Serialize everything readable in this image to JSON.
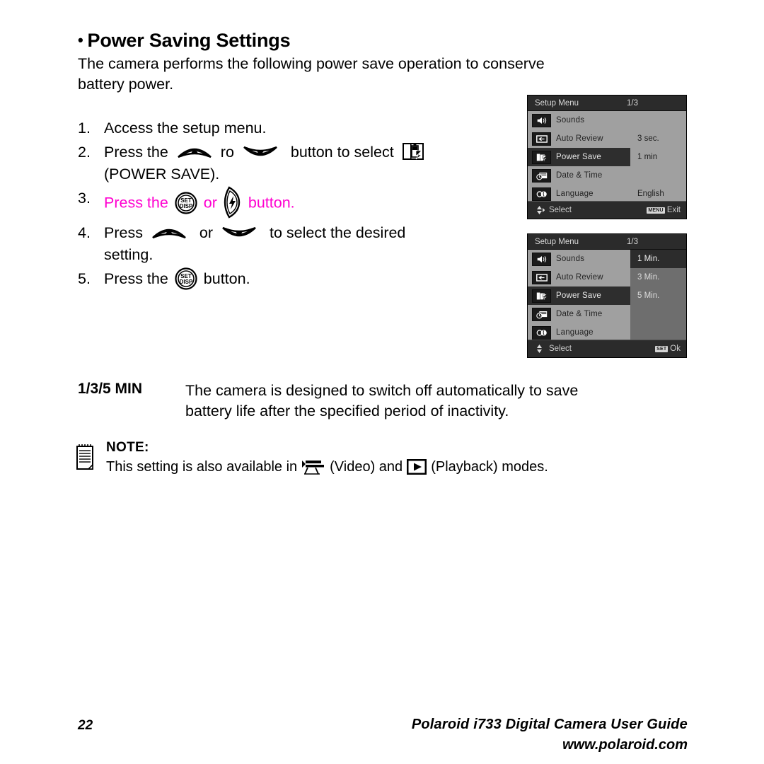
{
  "heading": {
    "bullet": "•",
    "title": "Power Saving Settings"
  },
  "intro": {
    "line1": "The camera performs the following power save operation to conserve",
    "line2": "battery power."
  },
  "steps": [
    {
      "num": "1.",
      "parts": [
        "Access the setup menu."
      ]
    },
    {
      "num": "2.",
      "pre": "Press the",
      "mid": "ro",
      "post": "button to select",
      "tail": "(POWER SAVE)."
    },
    {
      "num": "3.",
      "pre": "Press the",
      "mid": "or",
      "post": "button."
    },
    {
      "num": "4.",
      "pre": "Press",
      "mid": "or",
      "post": "to select the desired",
      "tail": "setting."
    },
    {
      "num": "5.",
      "pre": "Press the",
      "post": "button."
    }
  ],
  "lcd1": {
    "title": "Setup Menu",
    "page": "1/3",
    "rows": [
      {
        "icon": "speaker-icon",
        "label": "Sounds",
        "value": "",
        "selected": false
      },
      {
        "icon": "auto-review-icon",
        "label": "Auto Review",
        "value": "3 sec.",
        "selected": false
      },
      {
        "icon": "power-save-icon",
        "label": "Power Save",
        "value": "1 min",
        "selected": true
      },
      {
        "icon": "date-time-icon",
        "label": "Date & Time",
        "value": "",
        "selected": false
      },
      {
        "icon": "language-icon",
        "label": "Language",
        "value": "English",
        "selected": false
      }
    ],
    "footer_left": "Select",
    "footer_key": "MENU",
    "footer_right": "Exit"
  },
  "lcd2": {
    "title": "Setup Menu",
    "page": "1/3",
    "rows": [
      {
        "icon": "speaker-icon",
        "label": "Sounds",
        "selected": false
      },
      {
        "icon": "auto-review-icon",
        "label": "Auto Review",
        "selected": false
      },
      {
        "icon": "power-save-icon",
        "label": "Power Save",
        "selected": true
      },
      {
        "icon": "date-time-icon",
        "label": "Date & Time",
        "selected": false
      },
      {
        "icon": "language-icon",
        "label": "Language",
        "selected": false
      }
    ],
    "options": [
      {
        "label": "1 Min.",
        "selected": true
      },
      {
        "label": "3 Min.",
        "selected": false
      },
      {
        "label": "5 Min.",
        "selected": false
      }
    ],
    "footer_left": "Select",
    "footer_key": "SET",
    "footer_right": "Ok"
  },
  "minblock": {
    "label": "1/3/5 MIN",
    "line1": "The camera is designed to switch off automatically to save",
    "line2": "battery life after the specified period of inactivity."
  },
  "note": {
    "header": "NOTE:",
    "pre": "This setting is also available in",
    "mid": "(Video) and",
    "post": "(Playback) modes."
  },
  "footer": {
    "page_number": "22",
    "line1": "Polaroid i733 Digital Camera User Guide",
    "line2": "www.polaroid.com"
  },
  "colors": {
    "magenta": "#ff00d0",
    "lcd_panel_light": "#a0a0a0",
    "lcd_panel_dark": "#6e6e6e",
    "lcd_chrome": "#2b2b2b",
    "lcd_selected": "#2e2e2e"
  }
}
